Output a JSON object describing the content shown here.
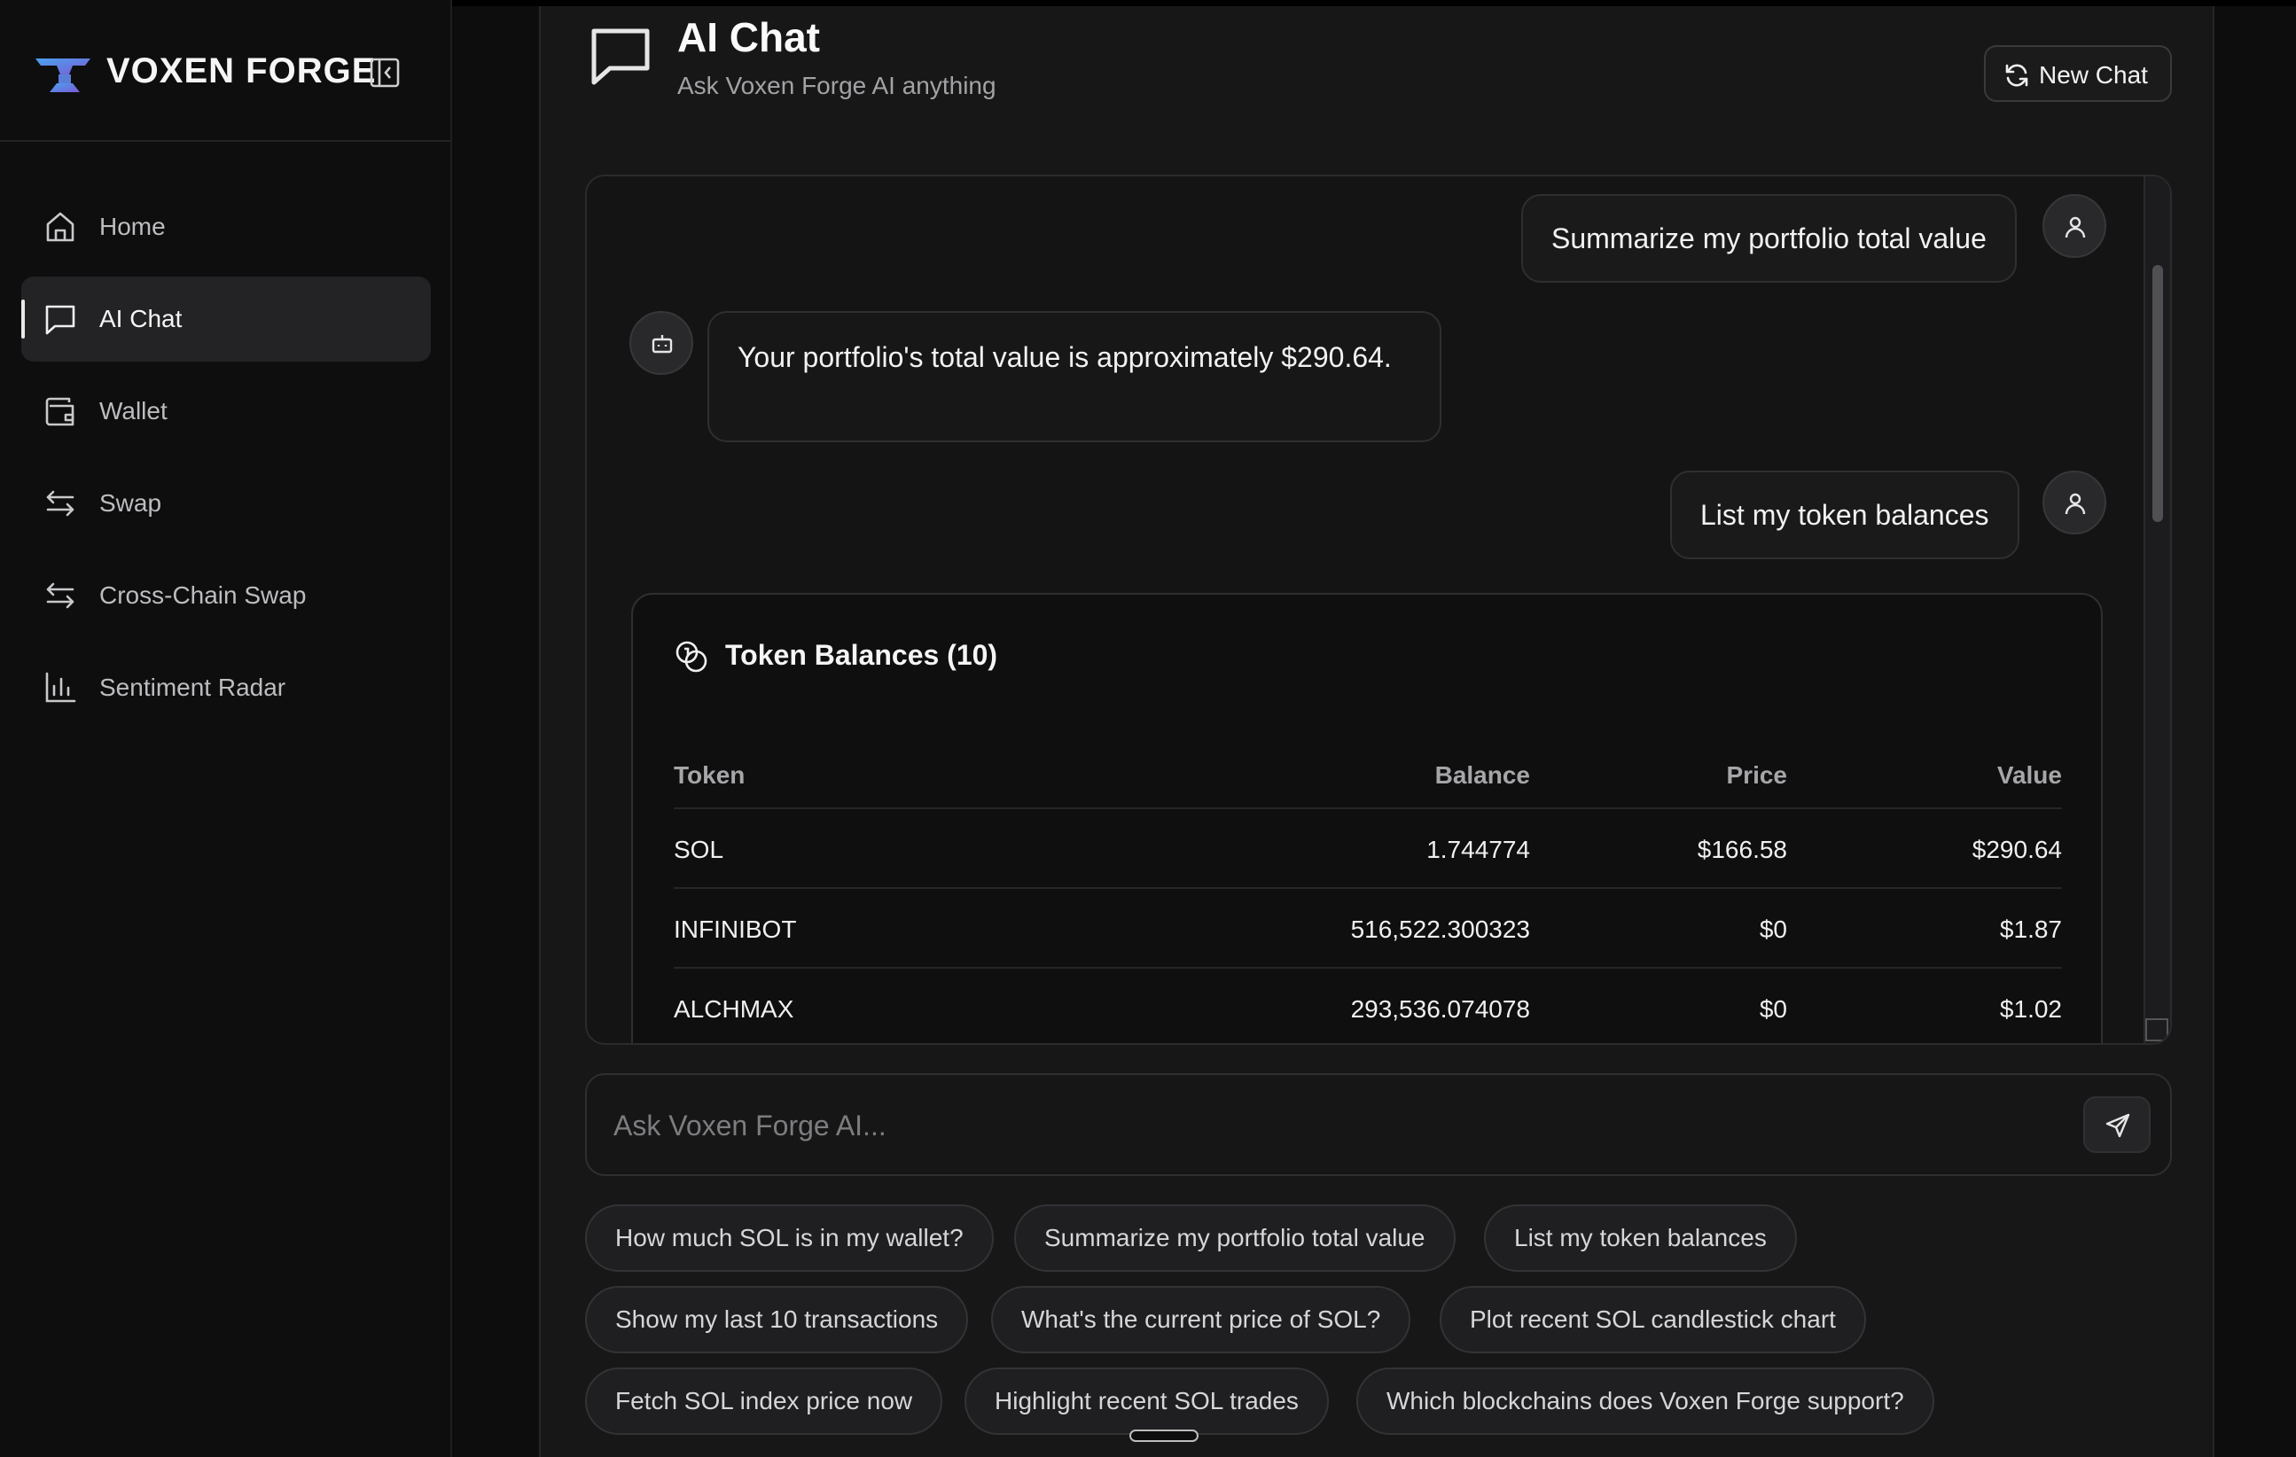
{
  "brand": {
    "name": "VOXEN FORGE"
  },
  "sidebar": {
    "items": [
      {
        "label": "Home",
        "icon": "home-icon"
      },
      {
        "label": "AI Chat",
        "icon": "chat-icon",
        "active": true
      },
      {
        "label": "Wallet",
        "icon": "wallet-icon"
      },
      {
        "label": "Swap",
        "icon": "swap-icon"
      },
      {
        "label": "Cross-Chain Swap",
        "icon": "cross-chain-swap-icon"
      },
      {
        "label": "Sentiment Radar",
        "icon": "bar-chart-icon"
      }
    ]
  },
  "header": {
    "title": "AI Chat",
    "subtitle": "Ask Voxen Forge AI anything",
    "new_chat_label": "New Chat"
  },
  "messages": {
    "user1": "Summarize my portfolio total value",
    "ai1": "Your portfolio's total value is approximately $290.64.",
    "user2": "List my token balances"
  },
  "token_card": {
    "title": "Token Balances (10)",
    "columns": [
      "Token",
      "Balance",
      "Price",
      "Value"
    ],
    "rows": [
      {
        "token": "SOL",
        "balance": "1.744774",
        "price": "$166.58",
        "value": "$290.64"
      },
      {
        "token": "INFINIBOT",
        "balance": "516,522.300323",
        "price": "$0",
        "value": "$1.87"
      },
      {
        "token": "ALCHMAX",
        "balance": "293,536.074078",
        "price": "$0",
        "value": "$1.02"
      }
    ]
  },
  "input": {
    "placeholder": "Ask Voxen Forge AI..."
  },
  "suggestions": [
    "How much SOL is in my wallet?",
    "Summarize my portfolio total value",
    "List my token balances",
    "Show my last 10 transactions",
    "What's the current price of SOL?",
    "Plot recent SOL candlestick chart",
    "Fetch SOL index price now",
    "Highlight recent SOL trades",
    "Which blockchains does Voxen Forge support?"
  ],
  "colors": {
    "background": "#0c0c0d",
    "panel": "#171718",
    "accent": "#f2f2f2",
    "logo_blue": "#3f8fe0",
    "logo_purple": "#7a5ad6"
  }
}
